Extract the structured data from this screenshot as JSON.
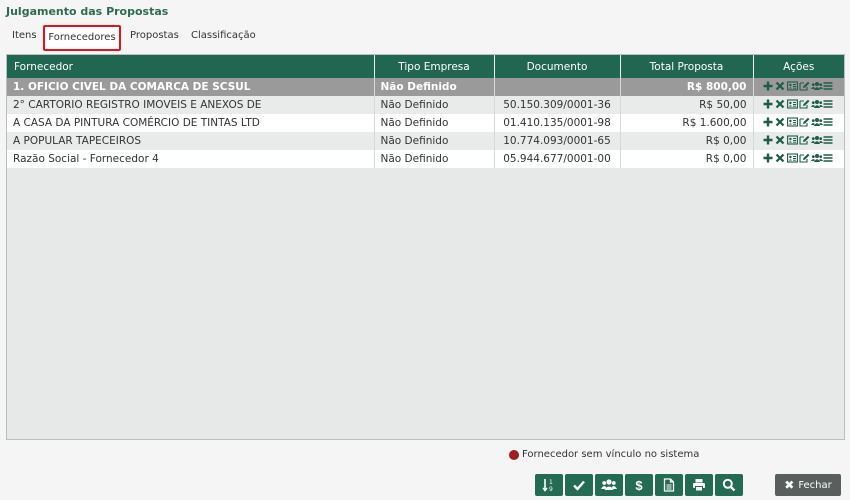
{
  "page": {
    "title": "Julgamento das Propostas"
  },
  "tabs": [
    {
      "label": "Itens",
      "active": false
    },
    {
      "label": "Fornecedores",
      "active": true
    },
    {
      "label": "Propostas",
      "active": false
    },
    {
      "label": "Classificação",
      "active": false
    }
  ],
  "table": {
    "headers": {
      "fornecedor": "Fornecedor",
      "tipo_empresa": "Tipo Empresa",
      "documento": "Documento",
      "total": "Total Proposta",
      "acoes": "Ações"
    },
    "rows": [
      {
        "fornecedor": "1. OFICIO CIVEL DA COMARCA DE SCSUL",
        "tipo": "Não Definido",
        "documento": "",
        "total": "R$ 800,00",
        "selected": true
      },
      {
        "fornecedor": "2° CARTORIO REGISTRO IMOVEIS E ANEXOS DE",
        "tipo": "Não Definido",
        "documento": "50.150.309/0001-36",
        "total": "R$ 50,00",
        "selected": false
      },
      {
        "fornecedor": "A CASA DA PINTURA COMÉRCIO DE TINTAS LTD",
        "tipo": "Não Definido",
        "documento": "01.410.135/0001-98",
        "total": "R$ 1.600,00",
        "selected": false
      },
      {
        "fornecedor": "A POPULAR TAPECEIROS",
        "tipo": "Não Definido",
        "documento": "10.774.093/0001-65",
        "total": "R$ 0,00",
        "selected": false
      },
      {
        "fornecedor": "Razão Social - Fornecedor 4",
        "tipo": "Não Definido",
        "documento": "05.944.677/0001-00",
        "total": "R$ 0,00",
        "selected": false
      }
    ],
    "row_actions": [
      "plus-icon",
      "remove-icon",
      "id-card-icon",
      "edit-icon",
      "users-icon",
      "menu-icon"
    ]
  },
  "legend": {
    "text": "Fornecedor sem vínculo no sistema",
    "color": "#a01c20"
  },
  "toolbar": {
    "buttons": [
      "sort-numeric-icon",
      "check-icon",
      "users-icon",
      "dollar-icon",
      "document-icon",
      "print-icon",
      "search-icon"
    ],
    "dollar_glyph": "$"
  },
  "close_button": {
    "label": "Fechar"
  },
  "colors": {
    "header_bg": "#206650",
    "title": "#2e6b4f",
    "accent_red": "#e0141a",
    "button": "#236b53"
  }
}
